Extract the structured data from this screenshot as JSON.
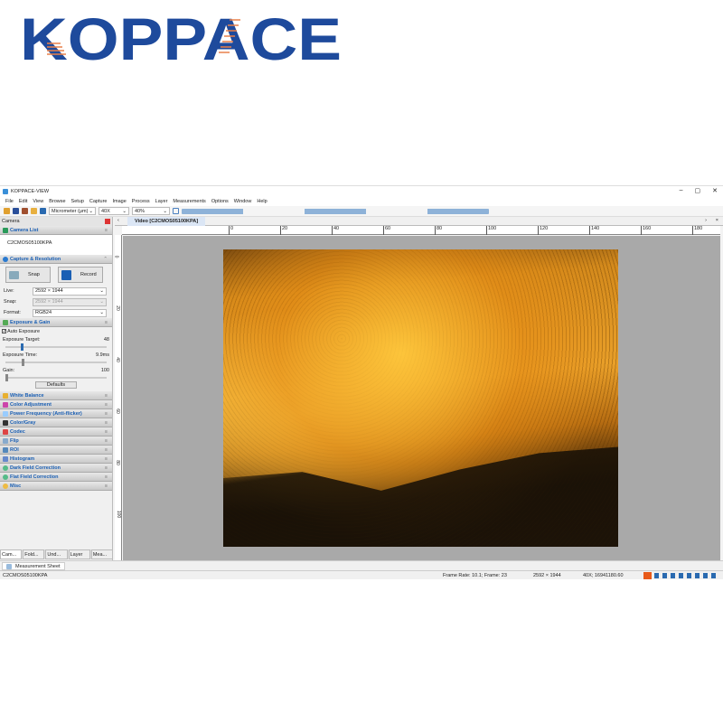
{
  "logo": "KOPPACE",
  "app": {
    "title": "KOPPACE-VIEW",
    "min": "–",
    "max": "▢",
    "close": "✕"
  },
  "menu": [
    "File",
    "Edit",
    "View",
    "Browse",
    "Setup",
    "Capture",
    "Image",
    "Process",
    "Layer",
    "Measurements",
    "Options",
    "Window",
    "Help"
  ],
  "toolbar": {
    "unit": "Micrometer (μm)",
    "magnification": "40X",
    "zoom": "40%"
  },
  "panel": {
    "title": "Camera",
    "camera_list": {
      "title": "Camera List",
      "camera": "C2CMOS05100KPA"
    },
    "capture": {
      "title": "Capture & Resolution",
      "snap": "Snap",
      "record": "Record",
      "live_label": "Live:",
      "live": "2592 × 1944",
      "snap_label": "Snap:",
      "snap_value": "2592 × 1944",
      "format_label": "Format:",
      "format": "RGB24"
    },
    "exposure": {
      "title": "Exposure & Gain",
      "auto": "Auto Exposure",
      "auto_checked": true,
      "target_label": "Exposure Target:",
      "target": "48",
      "time_label": "Exposure Time:",
      "time": "9.9ms",
      "gain_label": "Gain:",
      "gain": "100",
      "defaults": "Defaults"
    },
    "sections": [
      "White Balance",
      "Color Adjustment",
      "Power Frequency (Anti-flicker)",
      "Color/Gray",
      "Codec",
      "Flip",
      "ROI",
      "Histogram",
      "Dark Field Correction",
      "Flat Field Correction",
      "Misc"
    ],
    "tabs": [
      "Cam...",
      "Fold...",
      "Und...",
      "Layer",
      "Mea..."
    ]
  },
  "video": {
    "tab": "Video [C2CMOS05100KPA]",
    "ruler_top": [
      "0",
      "20",
      "40",
      "60",
      "80",
      "100",
      "120",
      "140",
      "160",
      "180"
    ],
    "ruler_left": [
      "0",
      "20",
      "40",
      "60",
      "80",
      "100"
    ]
  },
  "measurement_sheet": "Measurement Sheet",
  "status": {
    "camera": "C2CMOS05100KPA",
    "frame": "Frame Rate: 10.1; Frame: 23",
    "resolution": "2592 × 1944",
    "mag": "40X; 16941180.60"
  }
}
